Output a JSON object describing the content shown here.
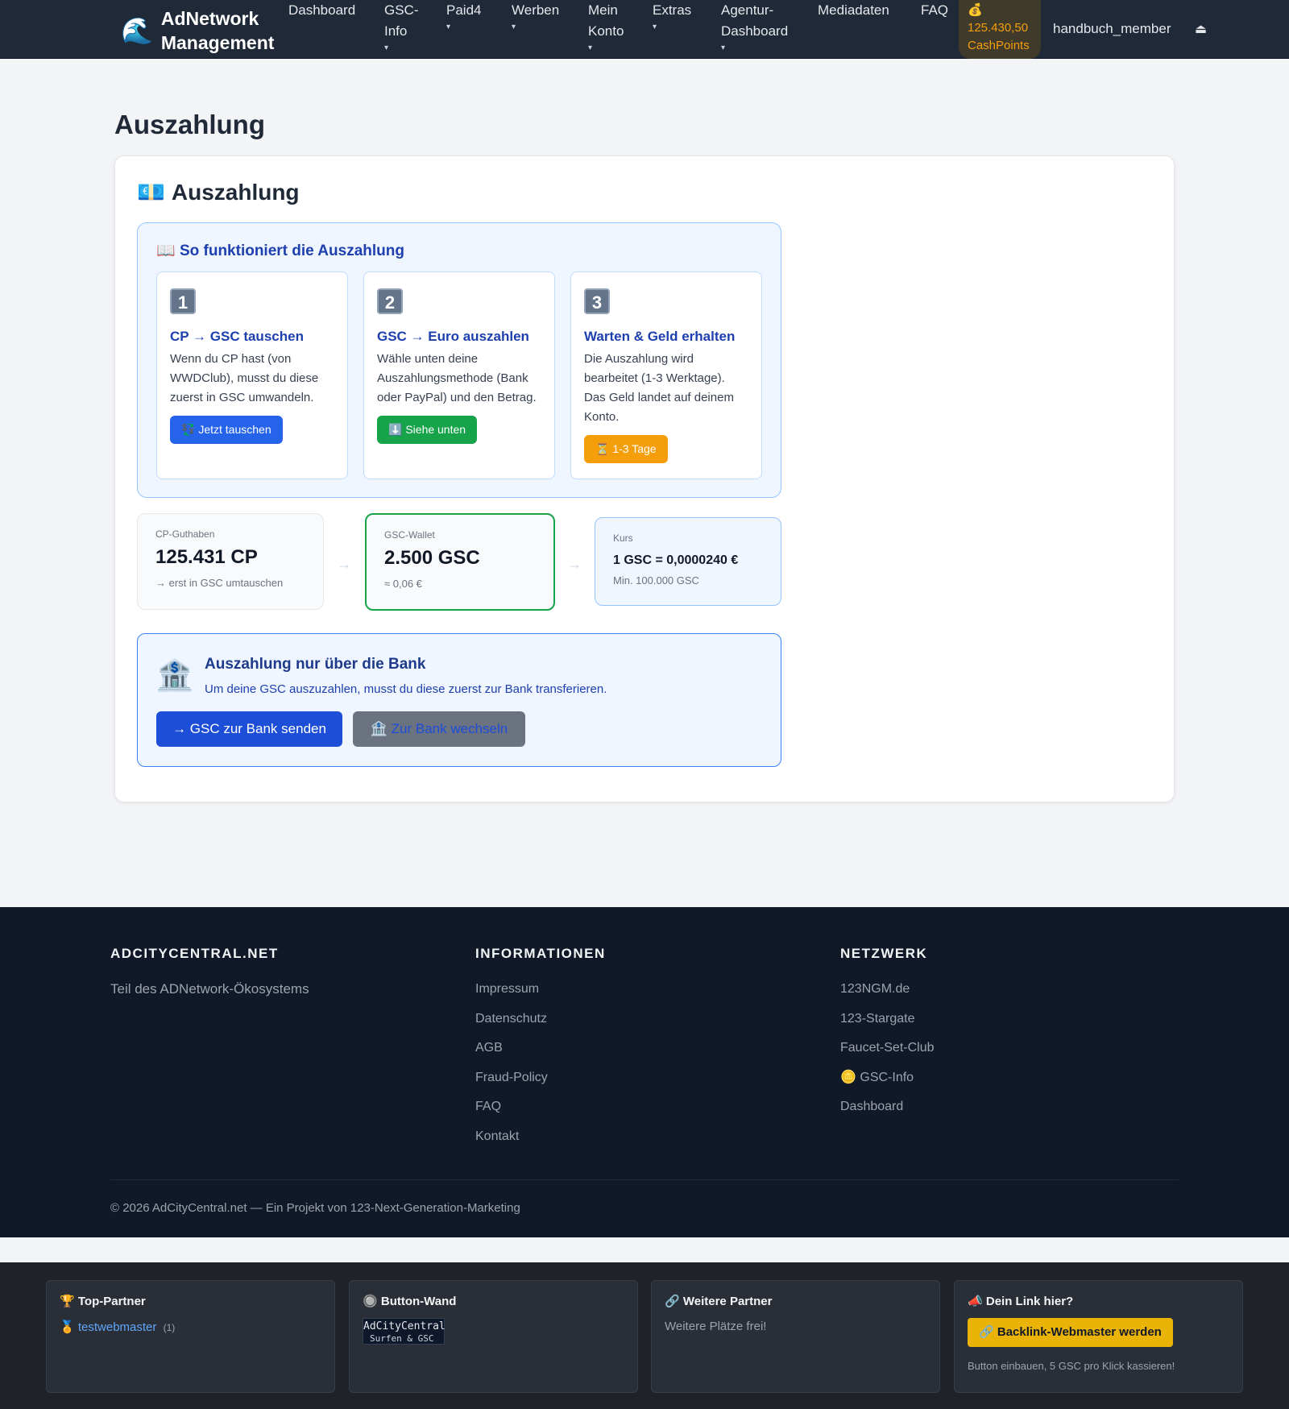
{
  "nav": {
    "brand_icon": "🌊",
    "brand_line1": "AdNetwork",
    "brand_line2": "Management",
    "items": [
      {
        "label": "Dashboard",
        "label2": ""
      },
      {
        "label": "GSC-",
        "label2": "Info"
      },
      {
        "label": "Paid4",
        "label2": "▾"
      },
      {
        "label": "Werben",
        "label2": "▾"
      },
      {
        "label": "Mein",
        "label2": "Konto"
      },
      {
        "label": "Extras",
        "label2": "▾"
      },
      {
        "label": "Agentur-",
        "label2": "Dashboard"
      },
      {
        "label": "Mediadaten",
        "label2": ""
      },
      {
        "label": "FAQ",
        "label2": ""
      }
    ],
    "caret": "▾",
    "cash_icon": "💰",
    "cash_value": "125.430,50",
    "cash_unit": "CashPoints",
    "username": "handbuch_member",
    "logout_icon": "⏏"
  },
  "page": {
    "title": "Auszahlung",
    "card_icon": "💶",
    "card_title": "Auszahlung"
  },
  "howto": {
    "icon": "📖",
    "title": "So funktioniert die Auszahlung",
    "steps": [
      {
        "num": "1",
        "title": "CP → GSC tauschen",
        "text": "Wenn du CP hast (von WWDClub), musst du diese zuerst in GSC umwandeln.",
        "button_icon": "💱",
        "button": "Jetzt tauschen",
        "color": "#2563eb"
      },
      {
        "num": "2",
        "title": "GSC → Euro auszahlen",
        "text": "Wähle unten deine Auszahlungsmethode (Bank oder PayPal) und den Betrag.",
        "button_icon": "⬇️",
        "button": "Siehe unten",
        "color": "#16a34a"
      },
      {
        "num": "3",
        "title": "Warten & Geld erhalten",
        "text": "Die Auszahlung wird bearbeitet (1-3 Werktage). Das Geld landet auf deinem Konto.",
        "button_icon": "⏳",
        "button": "1-3 Tage",
        "color": "#f59e0b"
      }
    ]
  },
  "stats": {
    "cp": {
      "label": "CP-Guthaben",
      "value": "125.431 CP",
      "sub": "→ erst in GSC umtauschen"
    },
    "arrow": "→",
    "gsc": {
      "label": "GSC-Wallet",
      "value": "2.500 GSC",
      "sub": "≈ 0,06 €"
    },
    "kurs": {
      "label": "Kurs",
      "value": "1 GSC = 0,0000240 €",
      "sub": "Min. 100.000 GSC"
    }
  },
  "bank": {
    "icon": "🏦",
    "title": "Auszahlung nur über die Bank",
    "text": "Um deine GSC auszuzahlen, musst du diese zuerst zur Bank transferieren.",
    "send_button": "→ GSC zur Bank senden",
    "switch_icon": "🏦",
    "switch_button": "Zur Bank wechseln"
  },
  "footer": {
    "col1_title": "ADCITYCENTRAL.NET",
    "col1_desc": "Teil des ADNetwork-Ökosystems",
    "col2_title": "INFORMATIONEN",
    "col2_links": [
      "Impressum",
      "Datenschutz",
      "AGB",
      "Fraud-Policy",
      "FAQ",
      "Kontakt"
    ],
    "col3_title": "NETZWERK",
    "col3_links": [
      "123NGM.de",
      "123-Stargate",
      "Faucet-Set-Club",
      "🪙 GSC-Info",
      "Dashboard"
    ],
    "copyright": "© 2026 AdCityCentral.net — Ein Projekt von 123-Next-Generation-Marketing"
  },
  "bottom": {
    "top_partner": {
      "icon": "🏆",
      "title": "Top-Partner",
      "medal": "🏅",
      "partner": "testwebmaster",
      "count": "(1)"
    },
    "button_wall": {
      "icon": "🔘",
      "title": "Button-Wand",
      "banner_line1": "AdCityCentral",
      "banner_line2": "Surfen & GSC"
    },
    "more_partners": {
      "icon": "🔗",
      "title": "Weitere Partner",
      "text": "Weitere Plätze frei!"
    },
    "your_link": {
      "icon": "📣",
      "title": "Dein Link hier?",
      "button_icon": "🔗",
      "button": "Backlink-Webmaster werden",
      "note": "Button einbauen, 5 GSC pro Klick kassieren!"
    }
  }
}
